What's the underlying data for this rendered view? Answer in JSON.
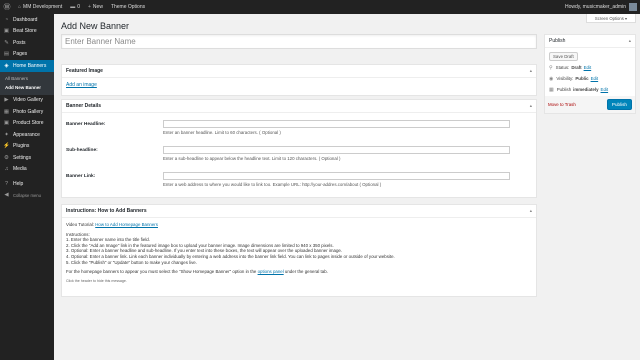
{
  "adminbar": {
    "wp_icon": "wordpress-logo-icon",
    "site_name": "MM Development",
    "comments_count": "0",
    "new_label": "New",
    "theme_options": "Theme Options",
    "greeting": "Howdy, musicmaker_admin"
  },
  "sidebar": {
    "items": [
      {
        "icon": "dashboard-icon",
        "glyph": "◔",
        "label": "Dashboard"
      },
      {
        "icon": "store-icon",
        "glyph": "▣",
        "label": "Beat Store"
      },
      {
        "icon": "pin-icon",
        "glyph": "✎",
        "label": "Posts"
      },
      {
        "icon": "page-icon",
        "glyph": "▤",
        "label": "Pages"
      },
      {
        "icon": "banner-icon",
        "glyph": "◈",
        "label": "Home Banners"
      }
    ],
    "submenu": [
      "All Banners",
      "Add New Banner"
    ],
    "items2": [
      {
        "icon": "video-icon",
        "glyph": "▶",
        "label": "Video Gallery"
      },
      {
        "icon": "photo-icon",
        "glyph": "▦",
        "label": "Photo Gallery"
      },
      {
        "icon": "store-icon",
        "glyph": "▣",
        "label": "Product Store"
      },
      {
        "icon": "appearance-icon",
        "glyph": "✦",
        "label": "Appearance"
      },
      {
        "icon": "plugin-icon",
        "glyph": "⚡",
        "label": "Plugins"
      },
      {
        "icon": "settings-icon",
        "glyph": "⚙",
        "label": "Settings"
      },
      {
        "icon": "media-icon",
        "glyph": "♫",
        "label": "Media"
      }
    ],
    "items3": [
      {
        "icon": "help-icon",
        "glyph": "?",
        "label": "Help"
      },
      {
        "icon": "collapse-icon",
        "glyph": "◀",
        "label": "Collapse menu"
      }
    ]
  },
  "screen_options": "Screen Options ▾",
  "page_title": "Add New Banner",
  "title_placeholder": "Enter Banner Name",
  "featured_image": {
    "title": "Featured Image",
    "link": "Add an image"
  },
  "banner_details": {
    "title": "Banner Details",
    "fields": [
      {
        "label": "Banner Headline:",
        "help": "Enter an banner headline. Limit to 60 characters. ( Optional )"
      },
      {
        "label": "Sub-headline:",
        "help": "Enter a sub-headline to appear below the headline text. Limit to 120 characters. ( Optional )"
      },
      {
        "label": "Banner Link:",
        "help": "Enter a web address to where you would like to link too. Example URL: http://your-addres.com/about ( Optional )"
      }
    ]
  },
  "instructions": {
    "title": "Instructions: How to Add Banners",
    "video_prefix": "Video Tutorial:",
    "video_link": "How to Add Homepage Banners",
    "heading": "Instructions:",
    "steps": [
      "1. Enter the banner name into the title field.",
      "2. Click the \"Add an Image\" link in the featured image box to upload your banner image. Image dimensions are limited to 940 x 350 pixels.",
      "3. Optional: Enter a banner headline and sub-headline. If you enter text into these boxes, the text will appear over the uploaded banner image.",
      "4. Optional: Enter a banner link. Link each banner individually by entering a web address into the banner link field. You can link to pages inside or outside of your website.",
      "5. Click the \"Publish\" or \"Update\" button to make your changes live."
    ],
    "note_prefix": "For the homepage banners to appear you must select the \"Show Homepage Banner\" option in the",
    "note_link": "options panel",
    "note_suffix": "under the general tab.",
    "footer": "Click the header to hide this message."
  },
  "publish": {
    "title": "Publish",
    "save_draft": "Save Draft",
    "status_label": "Status:",
    "status_value": "Draft",
    "visibility_label": "Visibility:",
    "visibility_value": "Public",
    "publish_label": "Publish",
    "publish_value": "immediately",
    "edit": "Edit",
    "trash": "Move to Trash",
    "publish_button": "Publish"
  },
  "colors": {
    "accent": "#0073aa",
    "primary_button": "#0085ba",
    "sidebar": "#222222"
  }
}
